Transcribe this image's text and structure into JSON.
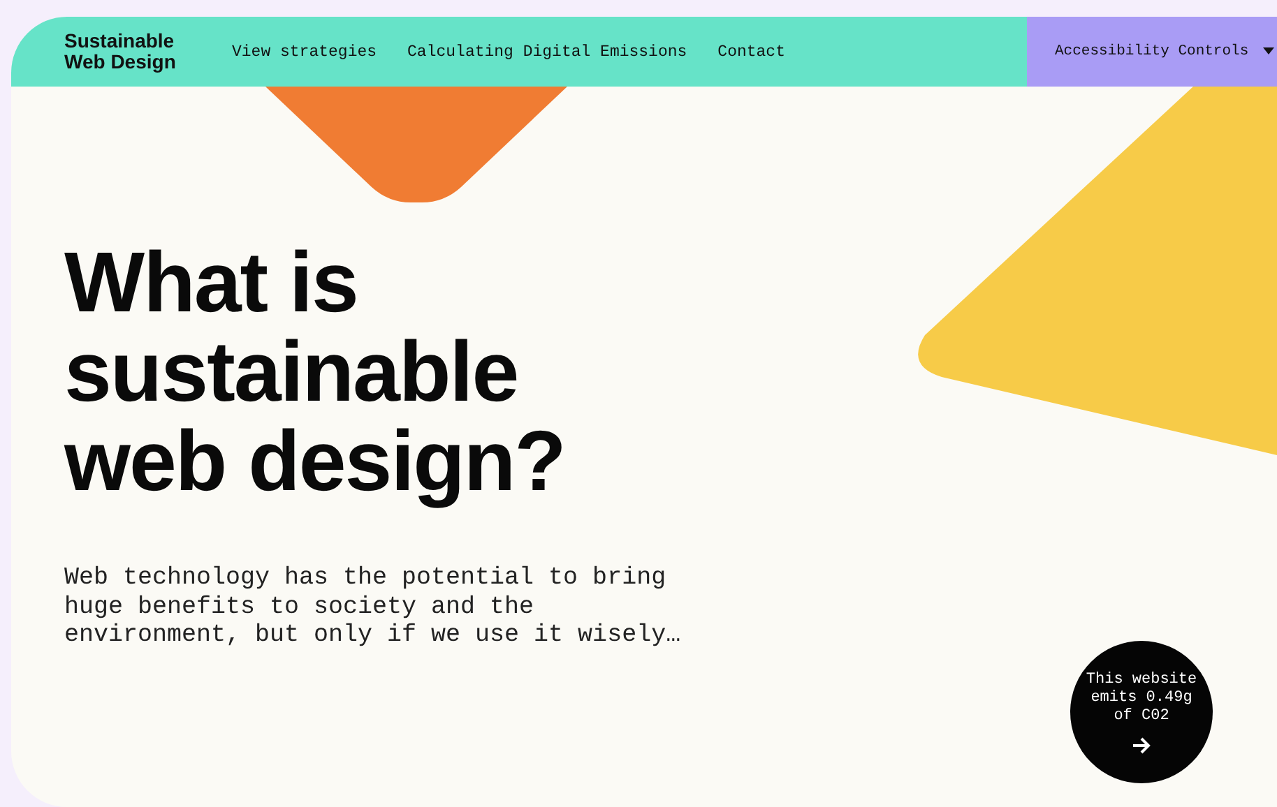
{
  "header": {
    "logo": "Sustainable Web Design",
    "nav_links": [
      {
        "label": "View strategies"
      },
      {
        "label": "Calculating Digital Emissions"
      },
      {
        "label": "Contact"
      }
    ],
    "accessibility_controls": {
      "label": "Accessibility Controls",
      "expanded": false
    }
  },
  "hero": {
    "heading": "What is sustainable web design?",
    "intro": "Web technology has the potential to bring huge benefits to society and the environment, but only if we use it wisely…"
  },
  "emissions_badge": {
    "text": "This website emits 0.49g of C02"
  }
}
